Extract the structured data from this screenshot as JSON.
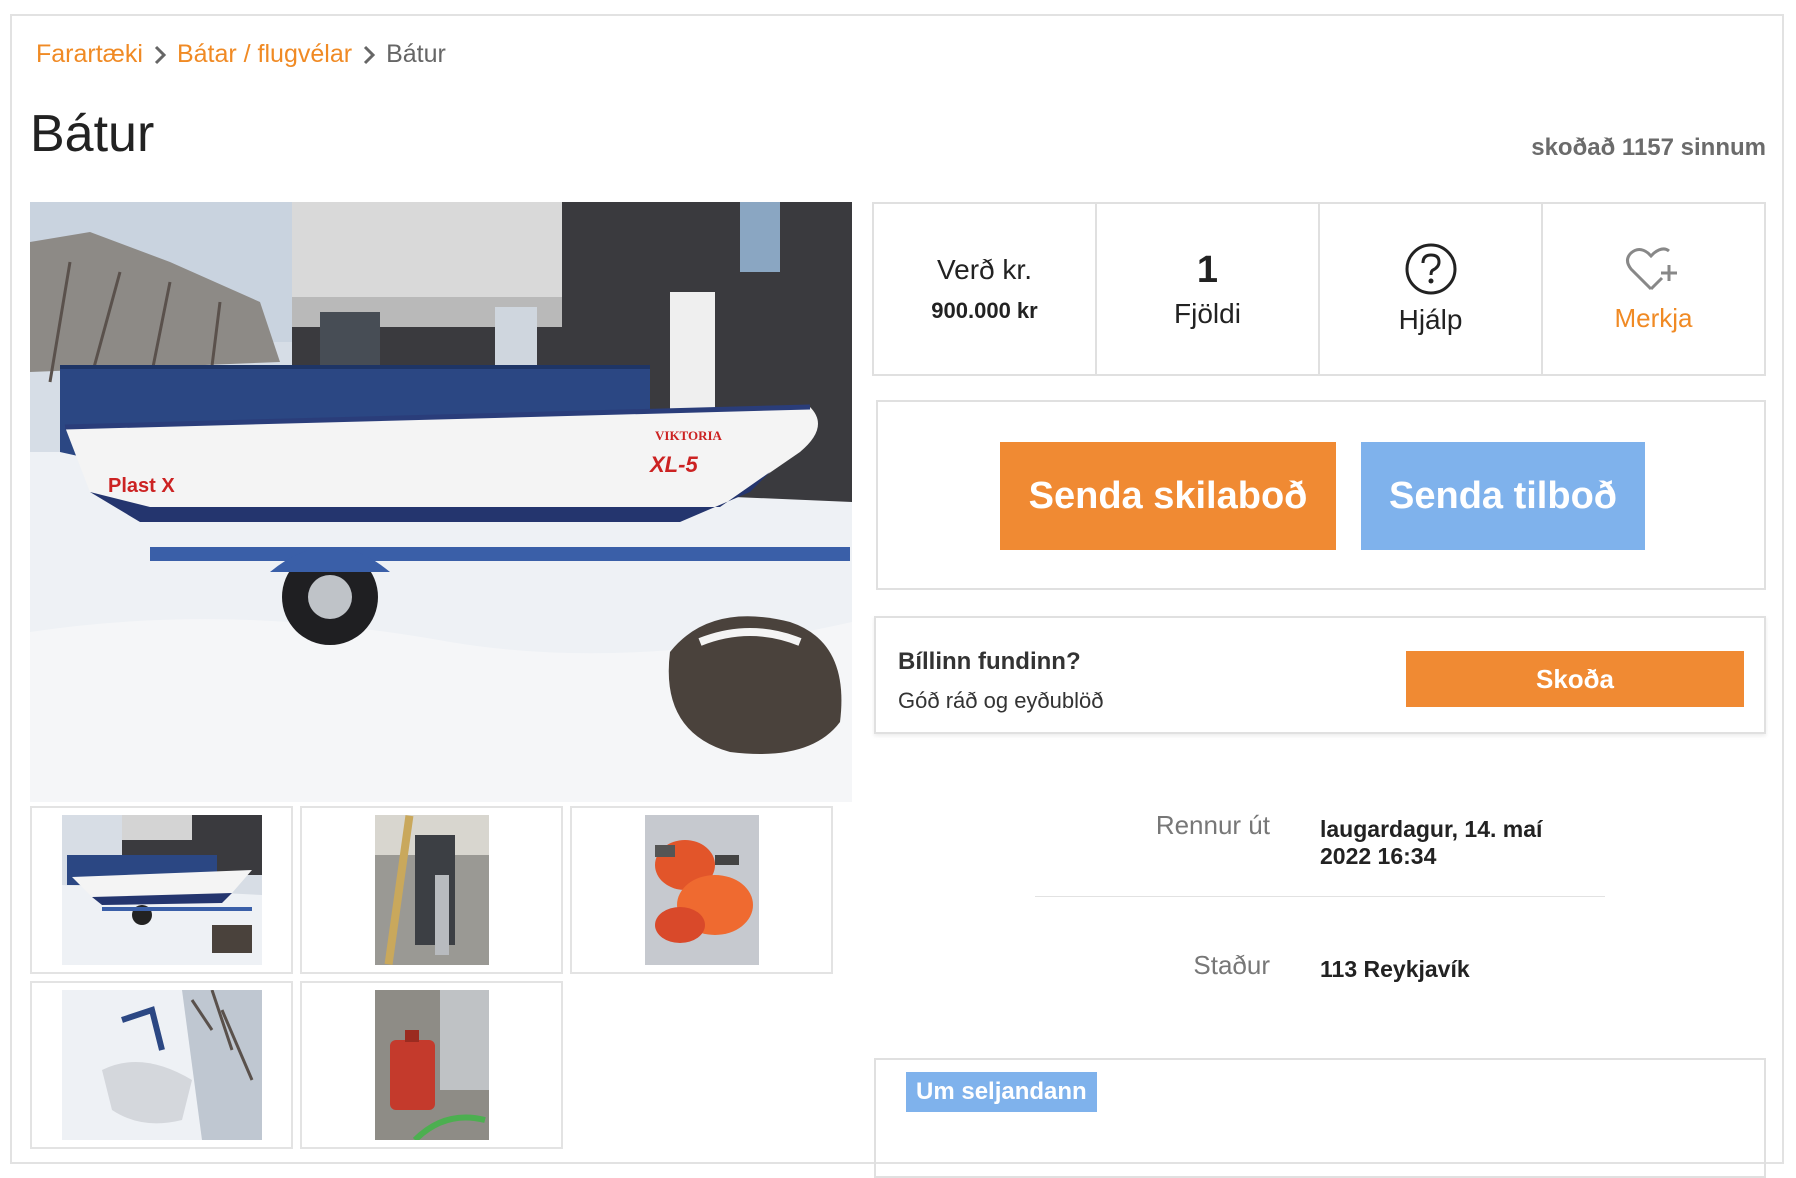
{
  "breadcrumb": {
    "items": [
      "Farartæki",
      "Bátar / flugvélar"
    ],
    "current": "Bátur"
  },
  "listing": {
    "title": "Bátur",
    "views": "skoðað 1157 sinnum"
  },
  "info": {
    "price_label": "Verð kr.",
    "price_value": "900.000 kr",
    "quantity_number": "1",
    "quantity_label": "Fjöldi",
    "help_label": "Hjálp",
    "favorite_label": "Merkja"
  },
  "actions": {
    "send_message": "Senda skilaboð",
    "send_offer": "Senda tilboð"
  },
  "found": {
    "title": "Bíllinn fundinn?",
    "subtitle": "Góð ráð og eyðublöð",
    "button": "Skoða"
  },
  "details": {
    "expires_label": "Rennur út",
    "expires_value_line1": "laugardagur, 14. maí",
    "expires_value_line2": "2022 16:34",
    "location_label": "Staður",
    "location_value": "113 Reykjavík"
  },
  "seller": {
    "tag": "Um seljandann"
  },
  "photo": {
    "boat_brand": "Plast X",
    "boat_model": "XL-5",
    "boat_name": "VIKTORIA"
  },
  "colors": {
    "accent_orange": "#f08a33",
    "accent_blue": "#7fb2ec"
  }
}
